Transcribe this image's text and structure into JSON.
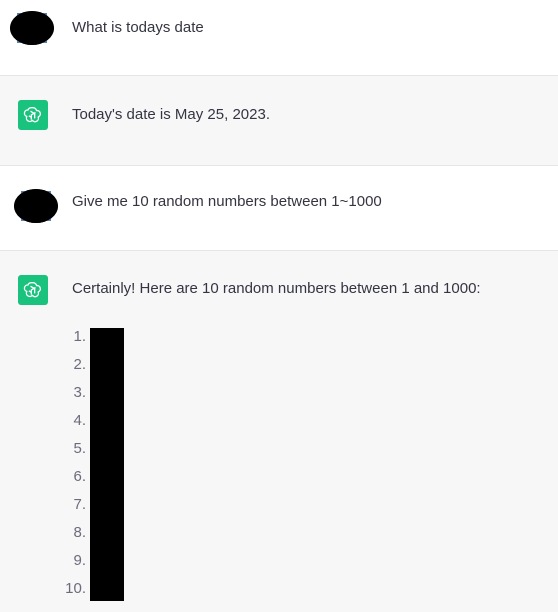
{
  "conversation": {
    "messages": [
      {
        "role": "user",
        "text": "What is todays date"
      },
      {
        "role": "assistant",
        "text": "Today's date is May 25, 2023."
      },
      {
        "role": "user",
        "text": "Give me 10 random numbers between 1~1000"
      },
      {
        "role": "assistant",
        "text": "Certainly! Here are 10 random numbers between 1 and 1000:"
      }
    ],
    "list_markers": [
      "1.",
      "2.",
      "3.",
      "4.",
      "5.",
      "6.",
      "7.",
      "8.",
      "9.",
      "10."
    ]
  },
  "colors": {
    "assistant_bg": "#f7f7f8",
    "user_bg": "#ffffff",
    "bot_avatar": "#19c37d",
    "text": "#343541",
    "marker_text": "#6b6c7b",
    "redaction": "#000000"
  },
  "icons": {
    "assistant_avatar": "openai-logo-icon",
    "user_avatar": "redacted-user-avatar"
  }
}
